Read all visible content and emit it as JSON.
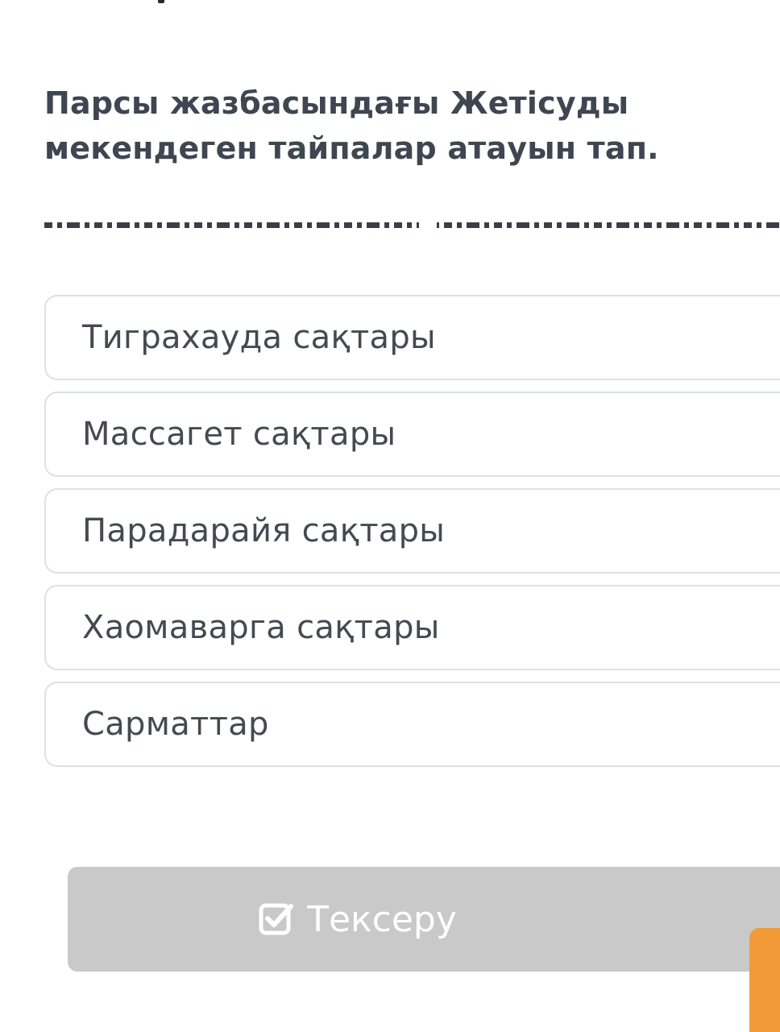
{
  "question": {
    "line1": "Парсы жазбасындағы Жетісуды",
    "line2": "мекендеген тайпалар атауын тап."
  },
  "options": [
    {
      "label": "Тиграхауда сақтары"
    },
    {
      "label": "Массагет сақтары"
    },
    {
      "label": "Парадарайя сақтары"
    },
    {
      "label": "Хаомаварга сақтары"
    },
    {
      "label": "Сарматтар"
    }
  ],
  "check_button": {
    "label": "Тексеру",
    "icon": "checkbox-checked-icon",
    "state": "disabled"
  },
  "colors": {
    "question_text": "#3f4651",
    "option_text": "#444a52",
    "option_border": "#dde1e6",
    "button_disabled_bg": "#c9c9c9",
    "accent_orange": "#f39a38"
  }
}
